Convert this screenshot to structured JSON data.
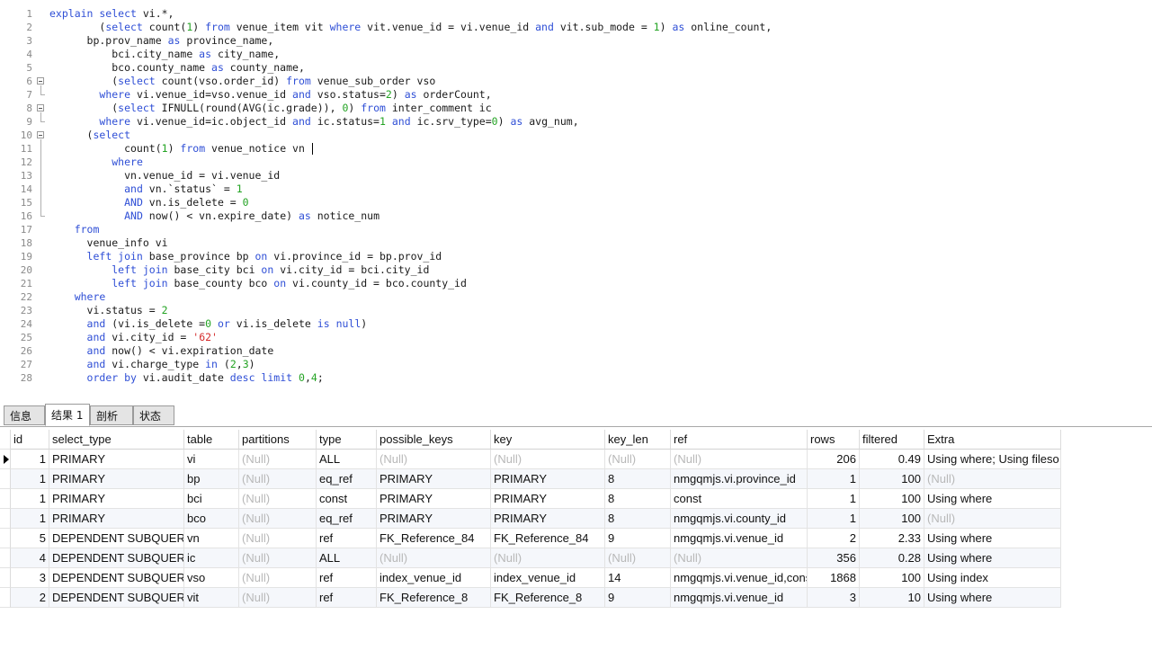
{
  "editor": {
    "lines": [
      {
        "n": "1",
        "segs": [
          [
            "k",
            "explain select"
          ],
          [
            "t",
            " vi.*,"
          ]
        ]
      },
      {
        "n": "2",
        "segs": [
          [
            "t",
            "        ("
          ],
          [
            "k",
            "select"
          ],
          [
            "t",
            " count("
          ],
          [
            "n",
            "1"
          ],
          [
            "t",
            ") "
          ],
          [
            "k",
            "from"
          ],
          [
            "t",
            " venue_item vit "
          ],
          [
            "k",
            "where"
          ],
          [
            "t",
            " vit.venue_id = vi.venue_id "
          ],
          [
            "k",
            "and"
          ],
          [
            "t",
            " vit.sub_mode = "
          ],
          [
            "n",
            "1"
          ],
          [
            "t",
            ") "
          ],
          [
            "k",
            "as"
          ],
          [
            "t",
            " online_count,"
          ]
        ]
      },
      {
        "n": "3",
        "segs": [
          [
            "t",
            "      bp.prov_name "
          ],
          [
            "k",
            "as"
          ],
          [
            "t",
            " province_name,"
          ]
        ]
      },
      {
        "n": "4",
        "segs": [
          [
            "t",
            "          bci.city_name "
          ],
          [
            "k",
            "as"
          ],
          [
            "t",
            " city_name,"
          ]
        ]
      },
      {
        "n": "5",
        "segs": [
          [
            "t",
            "          bco.county_name "
          ],
          [
            "k",
            "as"
          ],
          [
            "t",
            " county_name,"
          ]
        ]
      },
      {
        "n": "6",
        "segs": [
          [
            "t",
            "          ("
          ],
          [
            "k",
            "select"
          ],
          [
            "t",
            " count(vso.order_id) "
          ],
          [
            "k",
            "from"
          ],
          [
            "t",
            " venue_sub_order vso"
          ]
        ]
      },
      {
        "n": "7",
        "segs": [
          [
            "t",
            "        "
          ],
          [
            "k",
            "where"
          ],
          [
            "t",
            " vi.venue_id=vso.venue_id "
          ],
          [
            "k",
            "and"
          ],
          [
            "t",
            " vso.status="
          ],
          [
            "n",
            "2"
          ],
          [
            "t",
            ") "
          ],
          [
            "k",
            "as"
          ],
          [
            "t",
            " orderCount,"
          ]
        ]
      },
      {
        "n": "8",
        "segs": [
          [
            "t",
            "          ("
          ],
          [
            "k",
            "select"
          ],
          [
            "t",
            " IFNULL(round(AVG(ic.grade)), "
          ],
          [
            "n",
            "0"
          ],
          [
            "t",
            ") "
          ],
          [
            "k",
            "from"
          ],
          [
            "t",
            " inter_comment ic"
          ]
        ]
      },
      {
        "n": "9",
        "segs": [
          [
            "t",
            "        "
          ],
          [
            "k",
            "where"
          ],
          [
            "t",
            " vi.venue_id=ic.object_id "
          ],
          [
            "k",
            "and"
          ],
          [
            "t",
            " ic.status="
          ],
          [
            "n",
            "1"
          ],
          [
            "t",
            " "
          ],
          [
            "k",
            "and"
          ],
          [
            "t",
            " ic.srv_type="
          ],
          [
            "n",
            "0"
          ],
          [
            "t",
            ") "
          ],
          [
            "k",
            "as"
          ],
          [
            "t",
            " avg_num,"
          ]
        ]
      },
      {
        "n": "10",
        "segs": [
          [
            "t",
            "      ("
          ],
          [
            "k",
            "select"
          ]
        ]
      },
      {
        "n": "11",
        "segs": [
          [
            "t",
            "            count("
          ],
          [
            "n",
            "1"
          ],
          [
            "t",
            ") "
          ],
          [
            "k",
            "from"
          ],
          [
            "t",
            " venue_notice vn "
          ]
        ],
        "caret": true
      },
      {
        "n": "12",
        "segs": [
          [
            "t",
            "          "
          ],
          [
            "k",
            "where"
          ]
        ]
      },
      {
        "n": "13",
        "segs": [
          [
            "t",
            "            vn.venue_id = vi.venue_id"
          ]
        ]
      },
      {
        "n": "14",
        "segs": [
          [
            "t",
            "            "
          ],
          [
            "k",
            "and"
          ],
          [
            "t",
            " vn.`status` = "
          ],
          [
            "n",
            "1"
          ]
        ]
      },
      {
        "n": "15",
        "segs": [
          [
            "t",
            "            "
          ],
          [
            "k",
            "AND"
          ],
          [
            "t",
            " vn.is_delete = "
          ],
          [
            "n",
            "0"
          ]
        ]
      },
      {
        "n": "16",
        "segs": [
          [
            "t",
            "            "
          ],
          [
            "k",
            "AND"
          ],
          [
            "t",
            " now() < vn.expire_date) "
          ],
          [
            "k",
            "as"
          ],
          [
            "t",
            " notice_num"
          ]
        ]
      },
      {
        "n": "17",
        "segs": [
          [
            "t",
            "    "
          ],
          [
            "k",
            "from"
          ]
        ]
      },
      {
        "n": "18",
        "segs": [
          [
            "t",
            "      venue_info vi"
          ]
        ]
      },
      {
        "n": "19",
        "segs": [
          [
            "t",
            "      "
          ],
          [
            "k",
            "left join"
          ],
          [
            "t",
            " base_province bp "
          ],
          [
            "k",
            "on"
          ],
          [
            "t",
            " vi.province_id = bp.prov_id"
          ]
        ]
      },
      {
        "n": "20",
        "segs": [
          [
            "t",
            "          "
          ],
          [
            "k",
            "left join"
          ],
          [
            "t",
            " base_city bci "
          ],
          [
            "k",
            "on"
          ],
          [
            "t",
            " vi.city_id = bci.city_id"
          ]
        ]
      },
      {
        "n": "21",
        "segs": [
          [
            "t",
            "          "
          ],
          [
            "k",
            "left join"
          ],
          [
            "t",
            " base_county bco "
          ],
          [
            "k",
            "on"
          ],
          [
            "t",
            " vi.county_id = bco.county_id"
          ]
        ]
      },
      {
        "n": "22",
        "segs": [
          [
            "t",
            "    "
          ],
          [
            "k",
            "where"
          ]
        ]
      },
      {
        "n": "23",
        "segs": [
          [
            "t",
            "      vi.status = "
          ],
          [
            "n",
            "2"
          ]
        ]
      },
      {
        "n": "24",
        "segs": [
          [
            "t",
            "      "
          ],
          [
            "k",
            "and"
          ],
          [
            "t",
            " (vi.is_delete ="
          ],
          [
            "n",
            "0"
          ],
          [
            "t",
            " "
          ],
          [
            "k",
            "or"
          ],
          [
            "t",
            " vi.is_delete "
          ],
          [
            "k",
            "is"
          ],
          [
            "t",
            " "
          ],
          [
            "k",
            "null"
          ],
          [
            "t",
            ")"
          ]
        ]
      },
      {
        "n": "25",
        "segs": [
          [
            "t",
            "      "
          ],
          [
            "k",
            "and"
          ],
          [
            "t",
            " vi.city_id = "
          ],
          [
            "s",
            "'62'"
          ]
        ]
      },
      {
        "n": "26",
        "segs": [
          [
            "t",
            "      "
          ],
          [
            "k",
            "and"
          ],
          [
            "t",
            " now() < vi.expiration_date"
          ]
        ]
      },
      {
        "n": "27",
        "segs": [
          [
            "t",
            "      "
          ],
          [
            "k",
            "and"
          ],
          [
            "t",
            " vi.charge_type "
          ],
          [
            "k",
            "in"
          ],
          [
            "t",
            " ("
          ],
          [
            "n",
            "2"
          ],
          [
            "t",
            ","
          ],
          [
            "n",
            "3"
          ],
          [
            "t",
            ")"
          ]
        ]
      },
      {
        "n": "28",
        "segs": [
          [
            "t",
            "      "
          ],
          [
            "k",
            "order by"
          ],
          [
            "t",
            " vi.audit_date "
          ],
          [
            "k",
            "desc"
          ],
          [
            "t",
            " "
          ],
          [
            "k",
            "limit"
          ],
          [
            "t",
            " "
          ],
          [
            "n",
            "0"
          ],
          [
            "t",
            ","
          ],
          [
            "n",
            "4"
          ],
          [
            "t",
            ";"
          ]
        ]
      }
    ]
  },
  "tabs": [
    {
      "label": "信息",
      "active": false
    },
    {
      "label": "结果 1",
      "active": true
    },
    {
      "label": "剖析",
      "active": false
    },
    {
      "label": "状态",
      "active": false
    }
  ],
  "grid": {
    "columns": [
      "id",
      "select_type",
      "table",
      "partitions",
      "type",
      "possible_keys",
      "key",
      "key_len",
      "ref",
      "rows",
      "filtered",
      "Extra"
    ],
    "rows": [
      [
        "1",
        "PRIMARY",
        "vi",
        "(Null)",
        "ALL",
        "(Null)",
        "(Null)",
        "(Null)",
        "(Null)",
        "206",
        "0.49",
        "Using where; Using fileso"
      ],
      [
        "1",
        "PRIMARY",
        "bp",
        "(Null)",
        "eq_ref",
        "PRIMARY",
        "PRIMARY",
        "8",
        "nmgqmjs.vi.province_id",
        "1",
        "100",
        "(Null)"
      ],
      [
        "1",
        "PRIMARY",
        "bci",
        "(Null)",
        "const",
        "PRIMARY",
        "PRIMARY",
        "8",
        "const",
        "1",
        "100",
        "Using where"
      ],
      [
        "1",
        "PRIMARY",
        "bco",
        "(Null)",
        "eq_ref",
        "PRIMARY",
        "PRIMARY",
        "8",
        "nmgqmjs.vi.county_id",
        "1",
        "100",
        "(Null)"
      ],
      [
        "5",
        "DEPENDENT SUBQUERY",
        "vn",
        "(Null)",
        "ref",
        "FK_Reference_84",
        "FK_Reference_84",
        "9",
        "nmgqmjs.vi.venue_id",
        "2",
        "2.33",
        "Using where"
      ],
      [
        "4",
        "DEPENDENT SUBQUERY",
        "ic",
        "(Null)",
        "ALL",
        "(Null)",
        "(Null)",
        "(Null)",
        "(Null)",
        "356",
        "0.28",
        "Using where"
      ],
      [
        "3",
        "DEPENDENT SUBQUERY",
        "vso",
        "(Null)",
        "ref",
        "index_venue_id",
        "index_venue_id",
        "14",
        "nmgqmjs.vi.venue_id,cons",
        "1868",
        "100",
        "Using index"
      ],
      [
        "2",
        "DEPENDENT SUBQUERY",
        "vit",
        "(Null)",
        "ref",
        "FK_Reference_8",
        "FK_Reference_8",
        "9",
        "nmgqmjs.vi.venue_id",
        "3",
        "10",
        "Using where"
      ]
    ]
  },
  "colors": {
    "keyword": "#2f4fd6",
    "number": "#23a323",
    "string": "#d42b2b",
    "null_text": "#b8b8b8"
  }
}
